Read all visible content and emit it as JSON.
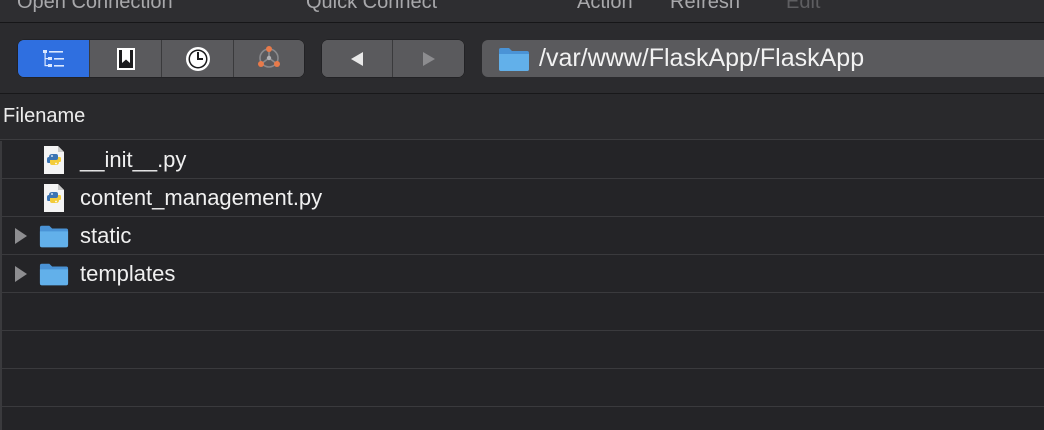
{
  "menu": {
    "open_connection": "Open Connection",
    "quick_connect": "Quick Connect",
    "action": "Action",
    "refresh": "Refresh",
    "edit": "Edit"
  },
  "view_buttons": [
    {
      "icon": "outline-view-icon",
      "active": true
    },
    {
      "icon": "bookmark-icon",
      "active": false
    },
    {
      "icon": "history-clock-icon",
      "active": false
    },
    {
      "icon": "bonjour-network-icon",
      "active": false
    }
  ],
  "navigation": {
    "back_icon": "back-arrow-icon",
    "forward_icon": "forward-arrow-icon"
  },
  "path": {
    "value": "/var/www/FlaskApp/FlaskApp",
    "icon": "folder-icon"
  },
  "list": {
    "column_header": "Filename",
    "rows": [
      {
        "name": "__init__.py",
        "type": "python-file",
        "expandable": false
      },
      {
        "name": "content_management.py",
        "type": "python-file",
        "expandable": false
      },
      {
        "name": "static",
        "type": "folder",
        "expandable": true
      },
      {
        "name": "templates",
        "type": "folder",
        "expandable": true
      }
    ]
  },
  "colors": {
    "accent": "#2f6fe0",
    "folder": "#5aa9e6",
    "background": "#242427"
  }
}
